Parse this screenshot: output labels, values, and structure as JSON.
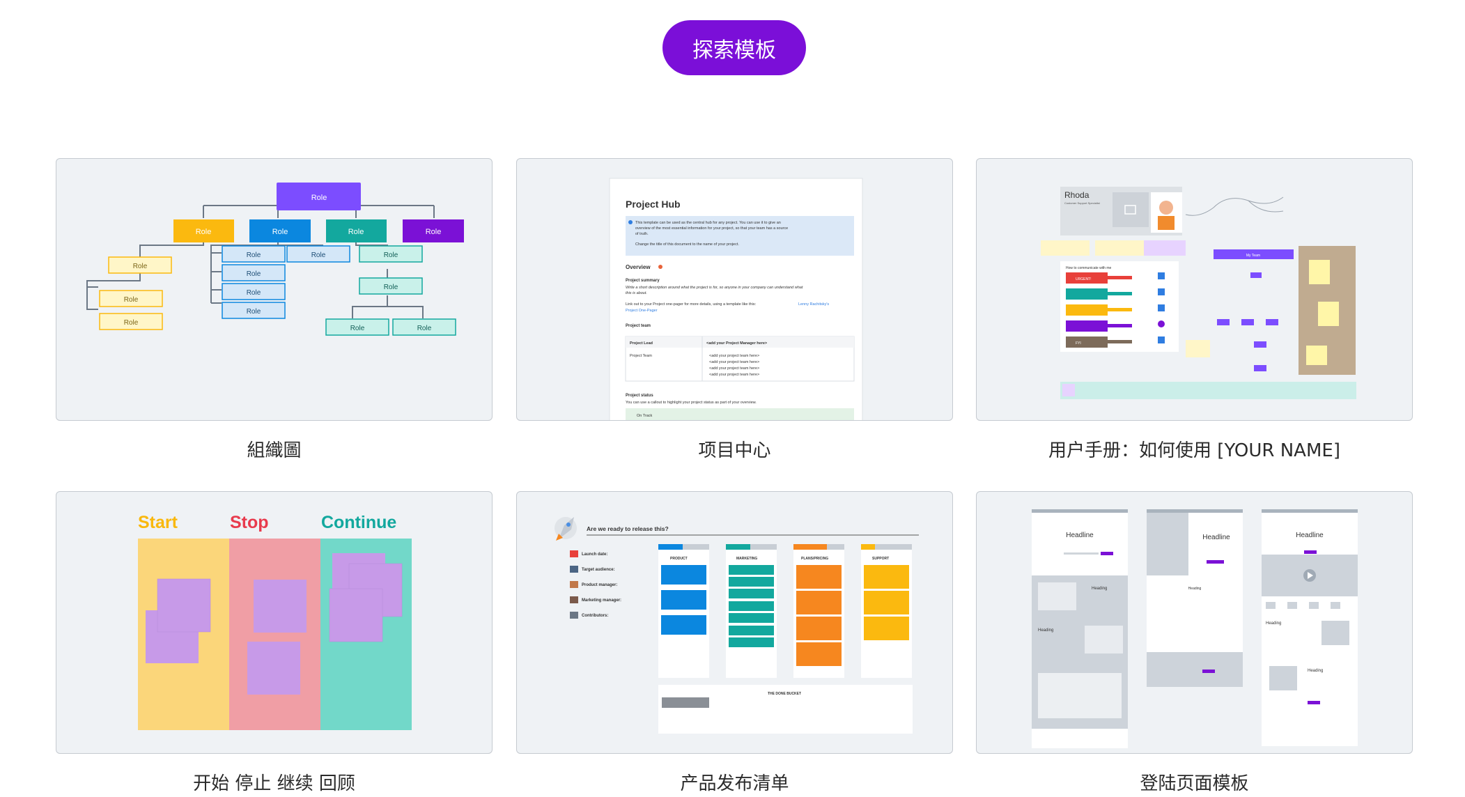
{
  "explore_button": {
    "label": "探索模板"
  },
  "templates": [
    {
      "caption": "組織圖",
      "thumb_text": {
        "role": "Role"
      }
    },
    {
      "caption": "项目中心",
      "thumb_text": {
        "title": "Project Hub",
        "callout1": "This template can be used as the central hub for any project. You can use it to give an",
        "callout2": "overview of the most essential information for your project, so that your team has a source",
        "callout3": "of truth.",
        "callout4": "Change the title of this document to the name of your project.",
        "overview": "Overview",
        "summary": "Project summary",
        "summary_desc1": "Write a short description around what the project is for, so anyone in your company can understand what",
        "summary_desc2": "this is about.",
        "link1": "Link out to your Project one-pager for more details, using a template like this:",
        "link2": "Lenny Rachitsky's",
        "link3": "Project One-Pager",
        "team": "Project team",
        "lead": "Project Lead",
        "lead_val": "<add your Project Manager here>",
        "team_row": "Project Team",
        "team_item": "<add your project team here>",
        "status": "Project status",
        "status_desc": "You can use a callout to highlight your project status as part of your overview.",
        "on_track": "On Track"
      }
    },
    {
      "caption": "用户手册：如何使用 [YOUR NAME]",
      "thumb_text": {
        "name": "Rhoda",
        "subtitle": "Customer Support Specialist",
        "my_team": "My Team",
        "communicate": "How to communicate with me",
        "urgent": "URGENT!",
        "fyi": "FYI"
      }
    },
    {
      "caption": "开始 停止 继续 回顾",
      "thumb_text": {
        "start": "Start",
        "stop": "Stop",
        "continue": "Continue"
      }
    },
    {
      "caption": "产品发布清单",
      "thumb_text": {
        "title": "Are we ready to release this?",
        "launch": "Launch date:",
        "audience": "Target audience:",
        "pm": "Product manager:",
        "mm": "Marketing manager:",
        "contrib": "Contributors:",
        "col1": "PRODUCT",
        "col2": "MARKETING",
        "col3": "PLANS/PRICING",
        "col4": "SUPPORT",
        "done": "THE DONE BUCKET"
      }
    },
    {
      "caption": "登陆页面模板",
      "thumb_text": {
        "headline": "Headline",
        "heading": "Heading"
      }
    }
  ],
  "colors": {
    "accent": "#7b0fd8",
    "purple": "#7c4dff",
    "yellow": "#fbb90f",
    "blue": "#0b87df",
    "teal": "#13a89e",
    "violet": "#7b11d6",
    "orange": "#f6871f"
  }
}
